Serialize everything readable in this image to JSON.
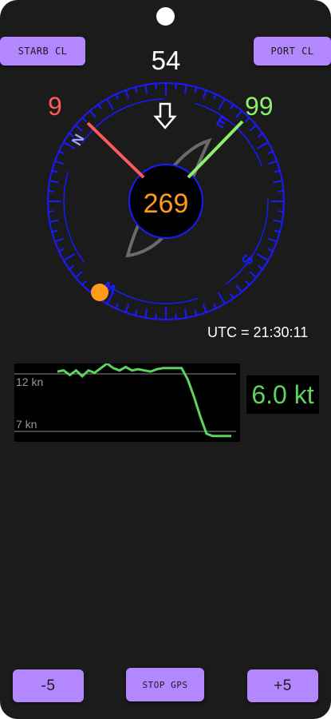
{
  "buttons": {
    "starboard_close": "STARB CL",
    "port_close": "PORT CL",
    "minus_five": "-5",
    "stop_gps": "STOP GPS",
    "plus_five": "+5"
  },
  "compass": {
    "heading_top": "54",
    "center_heading": "269",
    "starboard_angle": "9",
    "port_angle": "99",
    "cardinals": [
      "N",
      "E",
      "S",
      "W"
    ]
  },
  "utc_time": "UTC = 21:30:11",
  "speed": "6.0 kt",
  "colors": {
    "background": "#1b1b1b",
    "button": "#b388ff",
    "compass_blue": "#1a1aff",
    "starboard": "#ff5a5a",
    "port": "#8cf06c",
    "heading_orange": "#ff9b1a",
    "speed_green": "#5ed45e"
  },
  "chart_data": {
    "type": "line",
    "y_tick_labels": [
      "12 kn",
      "7 kn"
    ],
    "ylim": [
      7,
      12
    ],
    "series": [
      {
        "values": [
          12.2,
          12.3,
          11.9,
          12.3,
          11.8,
          12.3,
          12.1,
          12.5,
          12.9,
          12.5,
          12.3,
          12.6,
          12.3,
          12.4,
          12.3,
          12.2,
          12.4,
          12.5,
          12.5,
          12.5,
          12.5,
          11.5,
          10.0,
          8.3,
          6.8,
          6.6,
          6.6,
          6.6,
          6.6
        ]
      }
    ]
  }
}
